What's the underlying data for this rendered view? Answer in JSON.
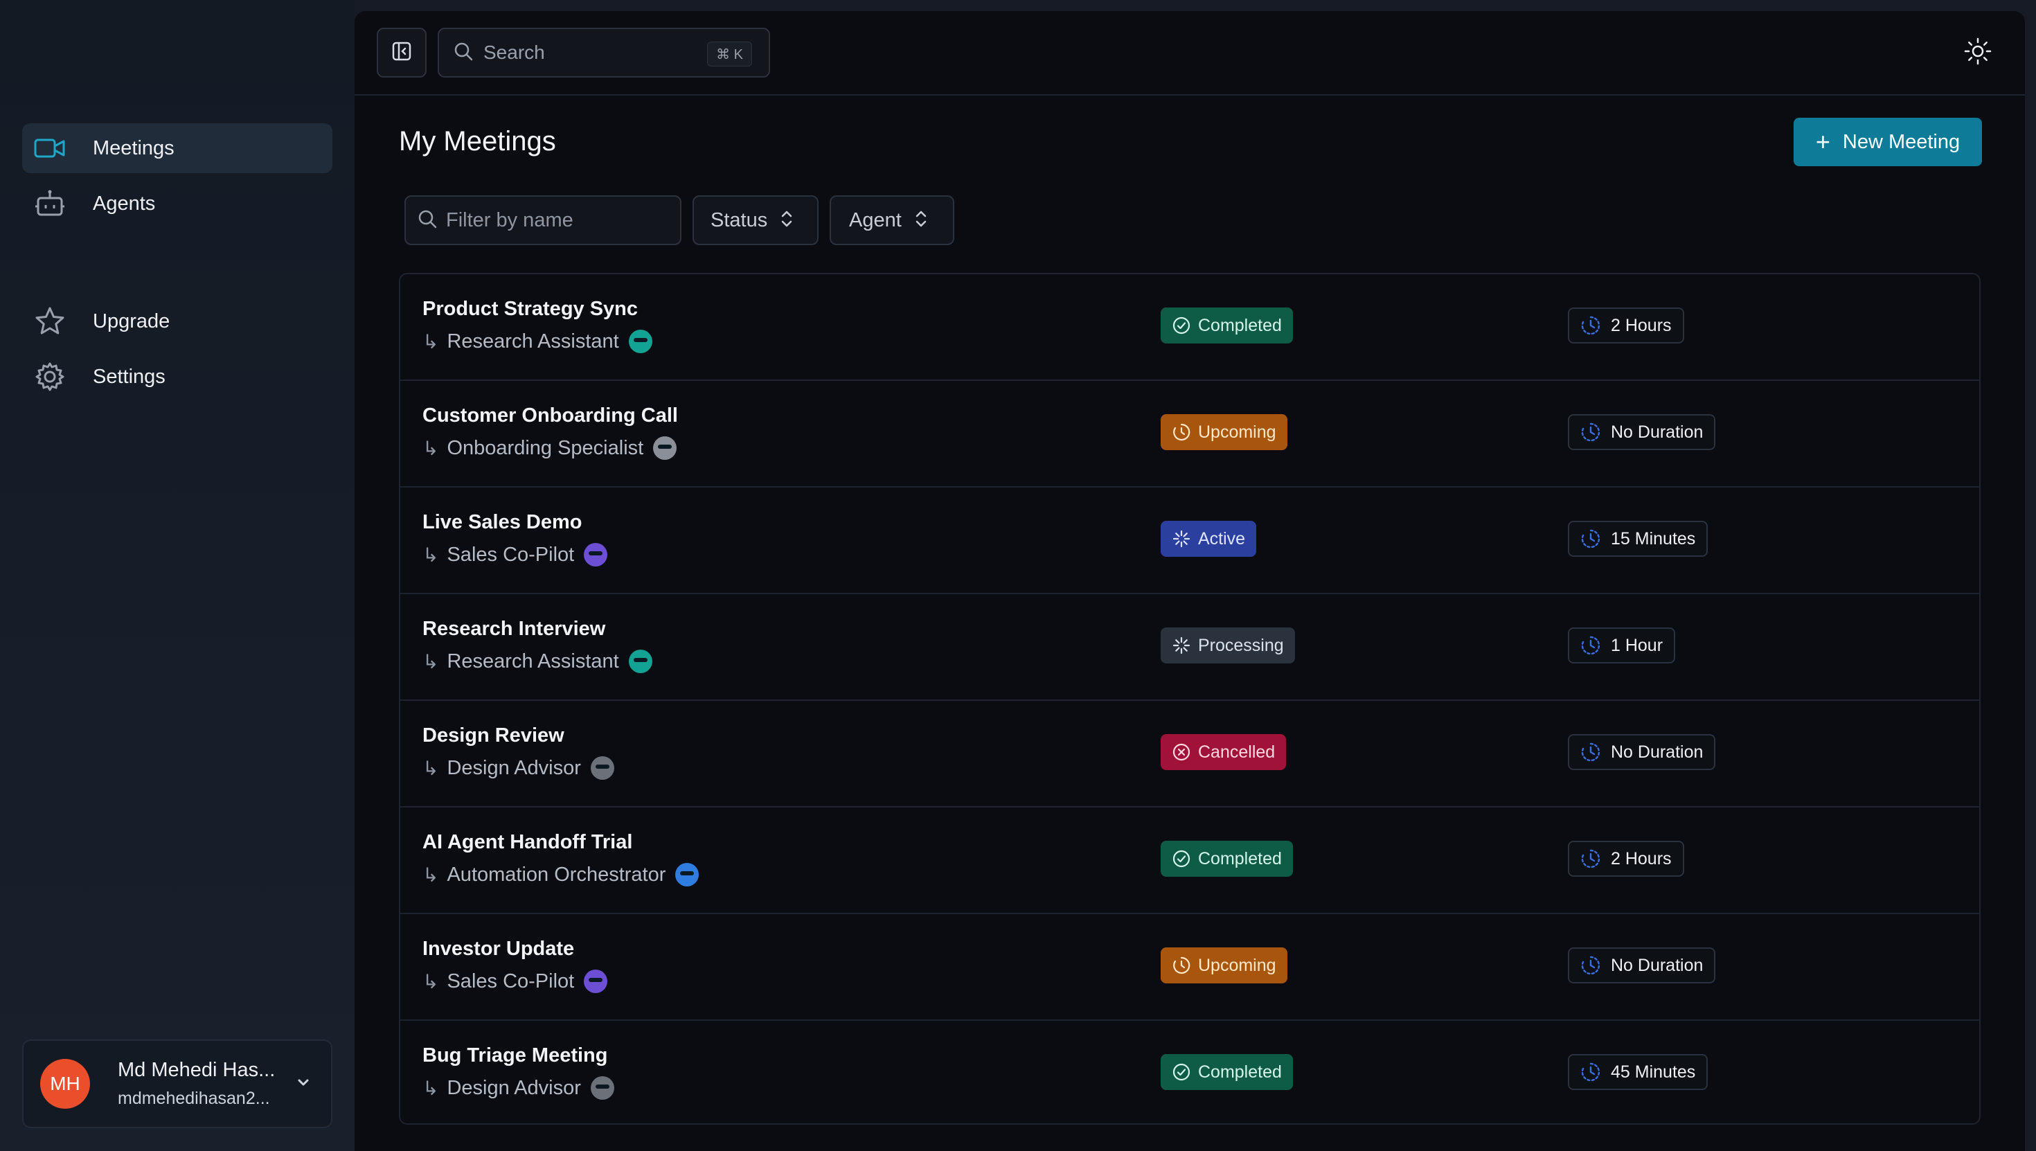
{
  "sidebar": {
    "items": [
      {
        "label": "Meetings",
        "icon": "video-icon",
        "active": true
      },
      {
        "label": "Agents",
        "icon": "bot-icon",
        "active": false
      },
      {
        "label": "Upgrade",
        "icon": "star-icon",
        "active": false
      },
      {
        "label": "Settings",
        "icon": "gear-icon",
        "active": false
      }
    ],
    "user": {
      "initials": "MH",
      "name": "Md Mehedi Has...",
      "email": "mdmehedihasan2..."
    }
  },
  "topbar": {
    "search_placeholder": "Search",
    "shortcut": "⌘ K"
  },
  "page": {
    "title": "My Meetings",
    "new_button": "New Meeting",
    "filter_placeholder": "Filter by name",
    "status_filter": "Status",
    "agent_filter": "Agent"
  },
  "colors": {
    "accent": "#0e7c98",
    "completed": "#0e5c45",
    "upcoming": "#a8560e",
    "active": "#2b3f9e",
    "processing": "#2a323e",
    "cancelled": "#a01237"
  },
  "meetings": [
    {
      "title": "Product Strategy Sync",
      "agent": "Research Assistant",
      "agent_color": "#13a394",
      "status": "Completed",
      "status_type": "completed",
      "duration": "2 Hours"
    },
    {
      "title": "Customer Onboarding Call",
      "agent": "Onboarding Specialist",
      "agent_color": "#8a8f98",
      "status": "Upcoming",
      "status_type": "upcoming",
      "duration": "No Duration"
    },
    {
      "title": "Live Sales Demo",
      "agent": "Sales Co-Pilot",
      "agent_color": "#6d4fd6",
      "status": "Active",
      "status_type": "active",
      "duration": "15 Minutes"
    },
    {
      "title": "Research Interview",
      "agent": "Research Assistant",
      "agent_color": "#13a394",
      "status": "Processing",
      "status_type": "processing",
      "duration": "1 Hour"
    },
    {
      "title": "Design Review",
      "agent": "Design Advisor",
      "agent_color": "#6b7079",
      "status": "Cancelled",
      "status_type": "cancelled",
      "duration": "No Duration"
    },
    {
      "title": "AI Agent Handoff Trial",
      "agent": "Automation Orchestrator",
      "agent_color": "#2f7de1",
      "status": "Completed",
      "status_type": "completed",
      "duration": "2 Hours"
    },
    {
      "title": "Investor Update",
      "agent": "Sales Co-Pilot",
      "agent_color": "#6d4fd6",
      "status": "Upcoming",
      "status_type": "upcoming",
      "duration": "No Duration"
    },
    {
      "title": "Bug Triage Meeting",
      "agent": "Design Advisor",
      "agent_color": "#6b7079",
      "status": "Completed",
      "status_type": "completed",
      "duration": "45 Minutes"
    }
  ]
}
